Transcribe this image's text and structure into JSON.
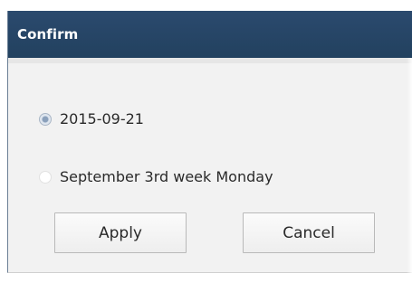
{
  "dialog": {
    "title": "Confirm",
    "options": [
      {
        "label": "2015-09-21",
        "selected": true
      },
      {
        "label": "September 3rd week Monday",
        "selected": false
      }
    ],
    "buttons": {
      "apply": "Apply",
      "cancel": "Cancel"
    }
  }
}
